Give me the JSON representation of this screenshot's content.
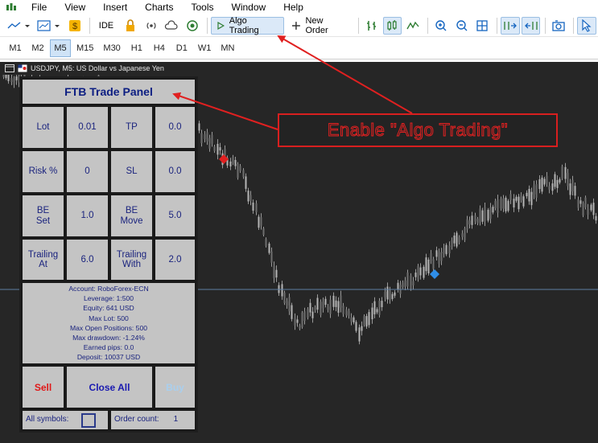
{
  "menu": {
    "items": [
      "File",
      "View",
      "Insert",
      "Charts",
      "Tools",
      "Window",
      "Help"
    ]
  },
  "toolbar": {
    "ide_label": "IDE",
    "algo_trading_label": "Algo Trading",
    "new_order_label": "New Order"
  },
  "timeframes": {
    "items": [
      "M1",
      "M2",
      "M5",
      "M15",
      "M30",
      "H1",
      "H4",
      "D1",
      "W1",
      "MN"
    ],
    "active": "M5"
  },
  "chart": {
    "header": "USDJPY, M5:  US Dollar vs Japanese Yen",
    "background": "#262626",
    "candle_color": "#9a9a9a",
    "marker_sell_color": "#e02020",
    "marker_buy_color": "#2f8ee8",
    "level_line_color": "#5d7fa3"
  },
  "panel": {
    "title": "FTB Trade Panel",
    "rows": [
      {
        "l1": "Lot",
        "v1": "0.01",
        "l2": "TP",
        "v2": "0.0"
      },
      {
        "l1": "Risk %",
        "v1": "0",
        "l2": "SL",
        "v2": "0.0"
      },
      {
        "l1": "BE Set",
        "v1": "1.0",
        "l2": "BE Move",
        "v2": "5.0"
      },
      {
        "l1": "Trailing At",
        "v1": "6.0",
        "l2": "Trailing With",
        "v2": "2.0"
      }
    ],
    "info": {
      "account": "Account: RoboForex-ECN",
      "leverage": "Leverage: 1:500",
      "equity": "Equity: 641 USD",
      "max_lot": "Max Lot: 500",
      "max_open_positions": "Max Open Positions: 500",
      "max_drawdown": "Max drawdown: -1.24%",
      "earned_pips": "Earned pips: 0.0",
      "deposit": "Deposit: 10037 USD"
    },
    "sell_label": "Sell",
    "close_all_label": "Close All",
    "buy_label": "Buy",
    "all_symbols_label": "All symbols:",
    "order_count_label": "Order count:",
    "order_count_value": "1",
    "colors": {
      "sell": "#e01818",
      "close_all": "#1a1ab0",
      "buy": "#a9cfee"
    }
  },
  "annotation": {
    "text": "Enable \"Algo Trading\"",
    "color": "#e02020"
  }
}
